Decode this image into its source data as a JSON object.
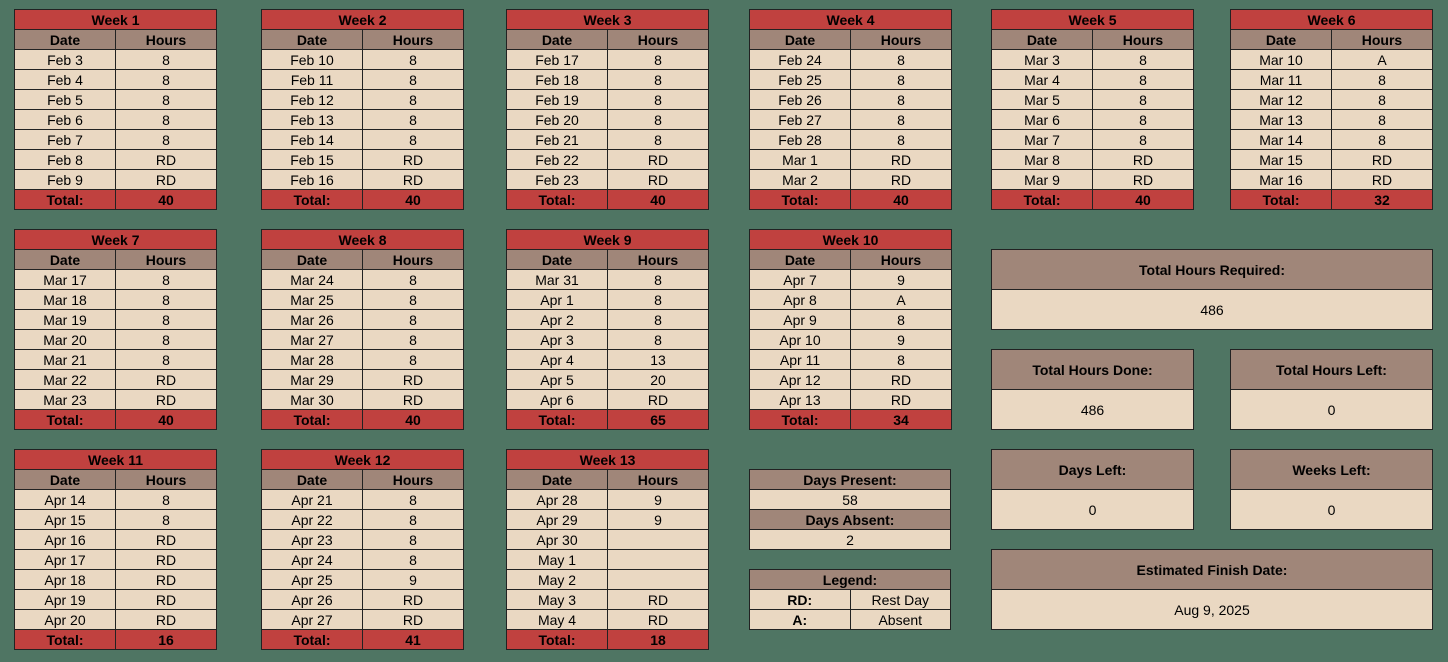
{
  "labels": {
    "date": "Date",
    "hours": "Hours",
    "total": "Total:"
  },
  "weeks": [
    {
      "title": "Week 1",
      "rows": [
        [
          "Feb 3",
          "8"
        ],
        [
          "Feb 4",
          "8"
        ],
        [
          "Feb 5",
          "8"
        ],
        [
          "Feb 6",
          "8"
        ],
        [
          "Feb 7",
          "8"
        ],
        [
          "Feb 8",
          "RD"
        ],
        [
          "Feb 9",
          "RD"
        ]
      ],
      "total": "40"
    },
    {
      "title": "Week 2",
      "rows": [
        [
          "Feb 10",
          "8"
        ],
        [
          "Feb 11",
          "8"
        ],
        [
          "Feb 12",
          "8"
        ],
        [
          "Feb 13",
          "8"
        ],
        [
          "Feb 14",
          "8"
        ],
        [
          "Feb 15",
          "RD"
        ],
        [
          "Feb 16",
          "RD"
        ]
      ],
      "total": "40"
    },
    {
      "title": "Week 3",
      "rows": [
        [
          "Feb 17",
          "8"
        ],
        [
          "Feb 18",
          "8"
        ],
        [
          "Feb 19",
          "8"
        ],
        [
          "Feb 20",
          "8"
        ],
        [
          "Feb 21",
          "8"
        ],
        [
          "Feb 22",
          "RD"
        ],
        [
          "Feb 23",
          "RD"
        ]
      ],
      "total": "40"
    },
    {
      "title": "Week 4",
      "rows": [
        [
          "Feb 24",
          "8"
        ],
        [
          "Feb 25",
          "8"
        ],
        [
          "Feb 26",
          "8"
        ],
        [
          "Feb 27",
          "8"
        ],
        [
          "Feb 28",
          "8"
        ],
        [
          "Mar 1",
          "RD"
        ],
        [
          "Mar 2",
          "RD"
        ]
      ],
      "total": "40"
    },
    {
      "title": "Week 5",
      "rows": [
        [
          "Mar 3",
          "8"
        ],
        [
          "Mar 4",
          "8"
        ],
        [
          "Mar 5",
          "8"
        ],
        [
          "Mar 6",
          "8"
        ],
        [
          "Mar 7",
          "8"
        ],
        [
          "Mar 8",
          "RD"
        ],
        [
          "Mar 9",
          "RD"
        ]
      ],
      "total": "40"
    },
    {
      "title": "Week 6",
      "rows": [
        [
          "Mar 10",
          "A"
        ],
        [
          "Mar 11",
          "8"
        ],
        [
          "Mar 12",
          "8"
        ],
        [
          "Mar 13",
          "8"
        ],
        [
          "Mar 14",
          "8"
        ],
        [
          "Mar 15",
          "RD"
        ],
        [
          "Mar 16",
          "RD"
        ]
      ],
      "total": "32"
    },
    {
      "title": "Week 7",
      "rows": [
        [
          "Mar 17",
          "8"
        ],
        [
          "Mar 18",
          "8"
        ],
        [
          "Mar 19",
          "8"
        ],
        [
          "Mar 20",
          "8"
        ],
        [
          "Mar 21",
          "8"
        ],
        [
          "Mar 22",
          "RD"
        ],
        [
          "Mar 23",
          "RD"
        ]
      ],
      "total": "40"
    },
    {
      "title": "Week 8",
      "rows": [
        [
          "Mar 24",
          "8"
        ],
        [
          "Mar 25",
          "8"
        ],
        [
          "Mar 26",
          "8"
        ],
        [
          "Mar 27",
          "8"
        ],
        [
          "Mar 28",
          "8"
        ],
        [
          "Mar 29",
          "RD"
        ],
        [
          "Mar 30",
          "RD"
        ]
      ],
      "total": "40"
    },
    {
      "title": "Week 9",
      "rows": [
        [
          "Mar 31",
          "8"
        ],
        [
          "Apr 1",
          "8"
        ],
        [
          "Apr 2",
          "8"
        ],
        [
          "Apr 3",
          "8"
        ],
        [
          "Apr 4",
          "13"
        ],
        [
          "Apr 5",
          "20"
        ],
        [
          "Apr 6",
          "RD"
        ]
      ],
      "total": "65"
    },
    {
      "title": "Week 10",
      "rows": [
        [
          "Apr 7",
          "9"
        ],
        [
          "Apr 8",
          "A"
        ],
        [
          "Apr 9",
          "8"
        ],
        [
          "Apr 10",
          "9"
        ],
        [
          "Apr 11",
          "8"
        ],
        [
          "Apr 12",
          "RD"
        ],
        [
          "Apr 13",
          "RD"
        ]
      ],
      "total": "34"
    },
    {
      "title": "Week 11",
      "rows": [
        [
          "Apr 14",
          "8"
        ],
        [
          "Apr 15",
          "8"
        ],
        [
          "Apr 16",
          "RD"
        ],
        [
          "Apr 17",
          "RD"
        ],
        [
          "Apr 18",
          "RD"
        ],
        [
          "Apr 19",
          "RD"
        ],
        [
          "Apr 20",
          "RD"
        ]
      ],
      "total": "16"
    },
    {
      "title": "Week 12",
      "rows": [
        [
          "Apr 21",
          "8"
        ],
        [
          "Apr 22",
          "8"
        ],
        [
          "Apr 23",
          "8"
        ],
        [
          "Apr 24",
          "8"
        ],
        [
          "Apr 25",
          "9"
        ],
        [
          "Apr 26",
          "RD"
        ],
        [
          "Apr 27",
          "RD"
        ]
      ],
      "total": "41"
    },
    {
      "title": "Week 13",
      "rows": [
        [
          "Apr 28",
          "9"
        ],
        [
          "Apr 29",
          "9"
        ],
        [
          "Apr 30",
          ""
        ],
        [
          "May 1",
          ""
        ],
        [
          "May 2",
          ""
        ],
        [
          "May 3",
          "RD"
        ],
        [
          "May 4",
          "RD"
        ]
      ],
      "total": "18"
    }
  ],
  "attendance": {
    "present_label": "Days Present:",
    "present": "58",
    "absent_label": "Days Absent:",
    "absent": "2"
  },
  "legend": {
    "title": "Legend:",
    "items": [
      [
        "RD:",
        "Rest Day"
      ],
      [
        "A:",
        "Absent"
      ]
    ]
  },
  "summary": {
    "required_label": "Total Hours Required:",
    "required": "486",
    "done_label": "Total Hours Done:",
    "done": "486",
    "left_label": "Total Hours Left:",
    "left": "0",
    "days_left_label": "Days Left:",
    "days_left": "0",
    "weeks_left_label": "Weeks Left:",
    "weeks_left": "0",
    "finish_label": "Estimated Finish Date:",
    "finish": "Aug 9, 2025"
  }
}
